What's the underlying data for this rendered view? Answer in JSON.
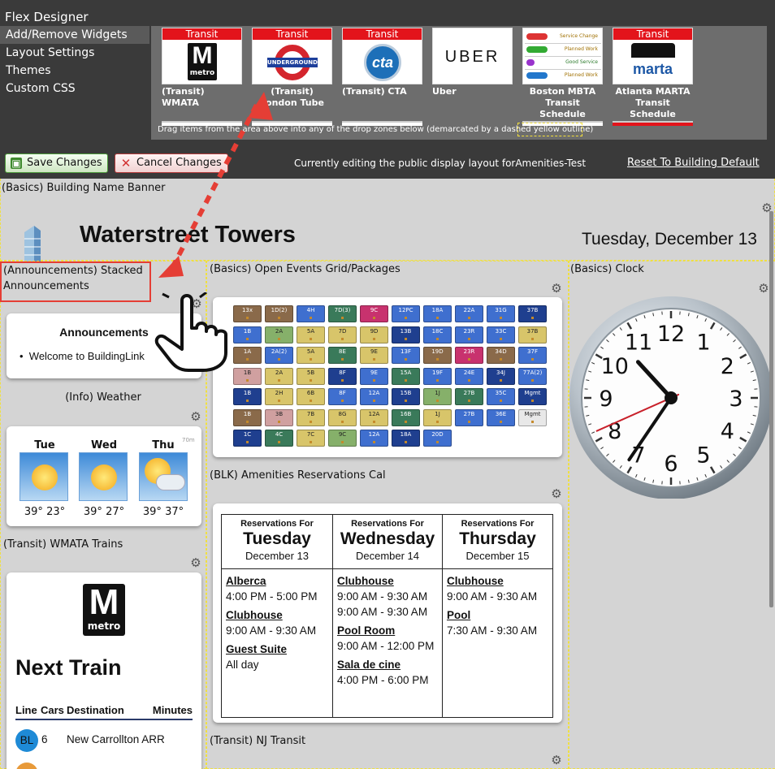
{
  "designer": {
    "title": "Flex Designer",
    "menu": [
      "Add/Remove Widgets",
      "Layout Settings",
      "Themes",
      "Custom CSS"
    ],
    "tiles": [
      {
        "banner": "Transit",
        "caption": "(Transit) WMATA",
        "logo": "metro-logo"
      },
      {
        "banner": "Transit",
        "caption": "(Transit) London Tube",
        "logo": "underground-logo"
      },
      {
        "banner": "Transit",
        "caption": "(Transit) CTA",
        "logo": "cta-logo"
      },
      {
        "banner": "",
        "caption": "Uber",
        "logo": "uber-logo",
        "logo_text": "UBER"
      },
      {
        "banner": "",
        "caption": "Boston MBTA Transit Schedule",
        "logo": "mbta-schedule-logo"
      },
      {
        "banner": "Transit",
        "caption": "Atlanta MARTA Transit Schedule",
        "logo": "marta-logo"
      }
    ],
    "mbta_rows": [
      "Service Change",
      "Planned Work",
      "Good Service",
      "Planned Work"
    ],
    "cta_text": "cta",
    "underground_text": "UNDERGROUND",
    "metro_letter": "M",
    "metro_text": "metro",
    "marta_text": "marta",
    "hint": "Drag items from the area above into any of the drop zones below (demarcated by a dashed yellow outline)",
    "save_label": "Save Changes",
    "cancel_label": "Cancel Changes",
    "editing_text": "Currently editing the public display layout forAmenities-Test",
    "reset_label": "Reset To Building Default"
  },
  "zones": {
    "banner": "(Basics) Building Name Banner",
    "announcements": "(Announcements) Stacked Announcements",
    "events": "(Basics) Open Events Grid/Packages",
    "clock": "(Basics) Clock",
    "weather": "(Info) Weather",
    "amenities": "(BLK) Amenities Reservations Cal",
    "wmata": "(Transit) WMATA Trains",
    "nj": "(Transit) NJ Transit"
  },
  "banner": {
    "building_name": "Waterstreet Towers",
    "date": "Tuesday, December 13"
  },
  "announcements": {
    "title": "Announcements",
    "items": [
      "Welcome to BuildingLink"
    ]
  },
  "weather": {
    "days": [
      {
        "day": "Tue",
        "temps": "39° 23°",
        "icon": "sun-icon"
      },
      {
        "day": "Wed",
        "temps": "39° 27°",
        "icon": "sun-icon"
      },
      {
        "day": "Thu",
        "temps": "39° 37°",
        "icon": "partly-cloudy-icon"
      }
    ],
    "badge": "70m"
  },
  "events_grid": {
    "rows": [
      [
        {
          "u": "13x",
          "c": "#8a6a4a"
        },
        {
          "u": "1D(2)",
          "c": "#8a6a4a"
        },
        {
          "u": "4H",
          "c": "#3f6fcf"
        },
        {
          "u": "7D(3)",
          "c": "#3a7a5a"
        },
        {
          "u": "9C",
          "c": "#c8326e"
        },
        {
          "u": "12PC",
          "c": "#3f6fcf"
        },
        {
          "u": "18A",
          "c": "#3f6fcf"
        },
        {
          "u": "22A",
          "c": "#3f6fcf"
        },
        {
          "u": "31G",
          "c": "#3f6fcf"
        },
        {
          "u": "37B",
          "c": "#1f3f8f"
        }
      ],
      [
        {
          "u": "1B",
          "c": "#3f6fcf"
        },
        {
          "u": "2A",
          "c": "#86b06a"
        },
        {
          "u": "5A",
          "c": "#d8c56a"
        },
        {
          "u": "7D",
          "c": "#d8c56a"
        },
        {
          "u": "9D",
          "c": "#d8c56a"
        },
        {
          "u": "13B",
          "c": "#1f3f8f"
        },
        {
          "u": "18C",
          "c": "#3f6fcf"
        },
        {
          "u": "23R",
          "c": "#3f6fcf"
        },
        {
          "u": "33C",
          "c": "#3f6fcf"
        },
        {
          "u": "37B",
          "c": "#d8c56a"
        }
      ],
      [
        {
          "u": "1A",
          "c": "#8a6a4a"
        },
        {
          "u": "2A(2)",
          "c": "#3f6fcf"
        },
        {
          "u": "5A",
          "c": "#d8c56a"
        },
        {
          "u": "8E",
          "c": "#3a7a5a"
        },
        {
          "u": "9E",
          "c": "#d8c56a"
        },
        {
          "u": "13F",
          "c": "#3f6fcf"
        },
        {
          "u": "19D",
          "c": "#8a6a4a"
        },
        {
          "u": "23R",
          "c": "#c8326e"
        },
        {
          "u": "34D",
          "c": "#8a6a4a"
        },
        {
          "u": "37F",
          "c": "#3f6fcf"
        }
      ],
      [
        {
          "u": "1B",
          "c": "#d0a0a0"
        },
        {
          "u": "2A",
          "c": "#d8c56a"
        },
        {
          "u": "5B",
          "c": "#d8c56a"
        },
        {
          "u": "8F",
          "c": "#1f3f8f"
        },
        {
          "u": "9E",
          "c": "#3f6fcf"
        },
        {
          "u": "15A",
          "c": "#3a7a5a"
        },
        {
          "u": "19F",
          "c": "#3f6fcf"
        },
        {
          "u": "24E",
          "c": "#3f6fcf"
        },
        {
          "u": "34J",
          "c": "#1f3f8f"
        },
        {
          "u": "77A(2)",
          "c": "#3f6fcf"
        }
      ],
      [
        {
          "u": "1B",
          "c": "#1f3f8f"
        },
        {
          "u": "2H",
          "c": "#d8c56a"
        },
        {
          "u": "6B",
          "c": "#d8c56a"
        },
        {
          "u": "8F",
          "c": "#3f6fcf"
        },
        {
          "u": "12A",
          "c": "#3f6fcf"
        },
        {
          "u": "15B",
          "c": "#1f3f8f"
        },
        {
          "u": "1J",
          "c": "#86b06a"
        },
        {
          "u": "27B",
          "c": "#3a7a5a"
        },
        {
          "u": "35C",
          "c": "#3f6fcf"
        },
        {
          "u": "Mgmt",
          "c": "#1f3f8f"
        }
      ],
      [
        {
          "u": "1B",
          "c": "#8a6a4a"
        },
        {
          "u": "3B",
          "c": "#d0a0a0"
        },
        {
          "u": "7B",
          "c": "#d8c56a"
        },
        {
          "u": "8G",
          "c": "#d8c56a"
        },
        {
          "u": "12A",
          "c": "#d8c56a"
        },
        {
          "u": "16B",
          "c": "#3a7a5a"
        },
        {
          "u": "1J",
          "c": "#d8c56a"
        },
        {
          "u": "27B",
          "c": "#3f6fcf"
        },
        {
          "u": "36E",
          "c": "#3f6fcf"
        },
        {
          "u": "Mgmt",
          "c": "#e8e8e8"
        }
      ],
      [
        {
          "u": "1C",
          "c": "#1f3f8f"
        },
        {
          "u": "4C",
          "c": "#3a7a5a"
        },
        {
          "u": "7C",
          "c": "#d8c56a"
        },
        {
          "u": "9C",
          "c": "#86b06a"
        },
        {
          "u": "12A",
          "c": "#3f6fcf"
        },
        {
          "u": "18A",
          "c": "#1f3f8f"
        },
        {
          "u": "20D",
          "c": "#3f6fcf"
        }
      ]
    ]
  },
  "reservations": {
    "header_label": "Reservations For",
    "columns": [
      {
        "day": "Tuesday",
        "date": "December 13",
        "entries": [
          {
            "room": "Alberca",
            "times": [
              "4:00 PM - 5:00 PM"
            ]
          },
          {
            "room": "Clubhouse",
            "times": [
              "9:00 AM - 9:30 AM"
            ]
          },
          {
            "room": "Guest Suite",
            "times": [
              "All day"
            ]
          }
        ]
      },
      {
        "day": "Wednesday",
        "date": "December 14",
        "entries": [
          {
            "room": "Clubhouse",
            "times": [
              "9:00 AM - 9:30 AM",
              "9:00 AM - 9:30 AM"
            ]
          },
          {
            "room": "Pool Room",
            "times": [
              "9:00 AM - 12:00 PM"
            ]
          },
          {
            "room": "Sala de cine",
            "times": [
              "4:00 PM - 6:00 PM"
            ]
          }
        ]
      },
      {
        "day": "Thursday",
        "date": "December 15",
        "entries": [
          {
            "room": "Clubhouse",
            "times": [
              "9:00 AM - 9:30 AM"
            ]
          },
          {
            "room": "Pool",
            "times": [
              "7:30 AM - 9:30 AM"
            ]
          }
        ]
      }
    ]
  },
  "clock": {
    "numbers": [
      "12",
      "1",
      "2",
      "3",
      "4",
      "5",
      "6",
      "7",
      "8",
      "9",
      "10",
      "11"
    ],
    "hour": 10,
    "minute": 35,
    "second": 41
  },
  "wmata": {
    "logo_letter": "M",
    "logo_text": "metro",
    "title": "Next Train",
    "columns": [
      "Line",
      "Cars",
      "Destination",
      "Minutes"
    ],
    "rows": [
      {
        "line": "BL",
        "cars": "6",
        "destination": "New Carrollton ARR",
        "color": "#1e8ad6"
      }
    ]
  },
  "colors": {
    "accent_red": "#e53e35",
    "drop_zone_yellow": "#f0e040",
    "transit_red": "#e3141b"
  }
}
